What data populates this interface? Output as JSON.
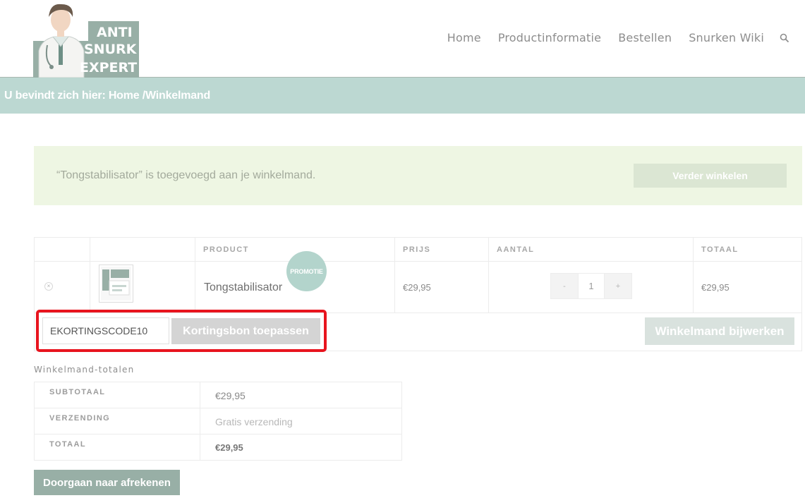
{
  "logo": {
    "lines": [
      "ANTI",
      "SNURK",
      "EXPERT"
    ]
  },
  "nav": {
    "items": [
      "Home",
      "Productinformatie",
      "Bestellen",
      "Snurken Wiki"
    ],
    "search_icon": "search-icon"
  },
  "breadcrumb": {
    "prefix": "U bevindt zich hier: ",
    "home": "Home",
    "separator": " /",
    "current": "Winkelmand"
  },
  "notice": {
    "message": "“Tongstabilisator” is toegevoegd aan je winkelmand.",
    "button": "Verder winkelen"
  },
  "cart": {
    "headers": {
      "product": "PRODUCT",
      "price": "PRIJS",
      "quantity": "AANTAL",
      "total": "TOTAAL"
    },
    "item": {
      "remove_icon": "close-icon",
      "name": "Tongstabilisator",
      "badge": "PROMOTIE",
      "price": "€29,95",
      "qty_minus": "-",
      "qty": "1",
      "qty_plus": "+",
      "total": "€29,95"
    },
    "coupon_value": "EKORTINGSCODE10",
    "coupon_button": "Kortingsbon toepassen",
    "update_button": "Winkelmand bijwerken"
  },
  "totals": {
    "title": "Winkelmand-totalen",
    "rows": [
      {
        "label": "SUBTOTAAL",
        "value": "€29,95"
      },
      {
        "label": "VERZENDING",
        "value": "Gratis verzending"
      },
      {
        "label": "TOTAAL",
        "value": "€29,95"
      }
    ],
    "checkout_button": "Doorgaan naar afrekenen"
  },
  "colors": {
    "brand": "#98afa6",
    "breadcrumb_bg": "#bcd8d2",
    "notice_bg": "#eef6e3",
    "highlight": "#e8141e"
  }
}
